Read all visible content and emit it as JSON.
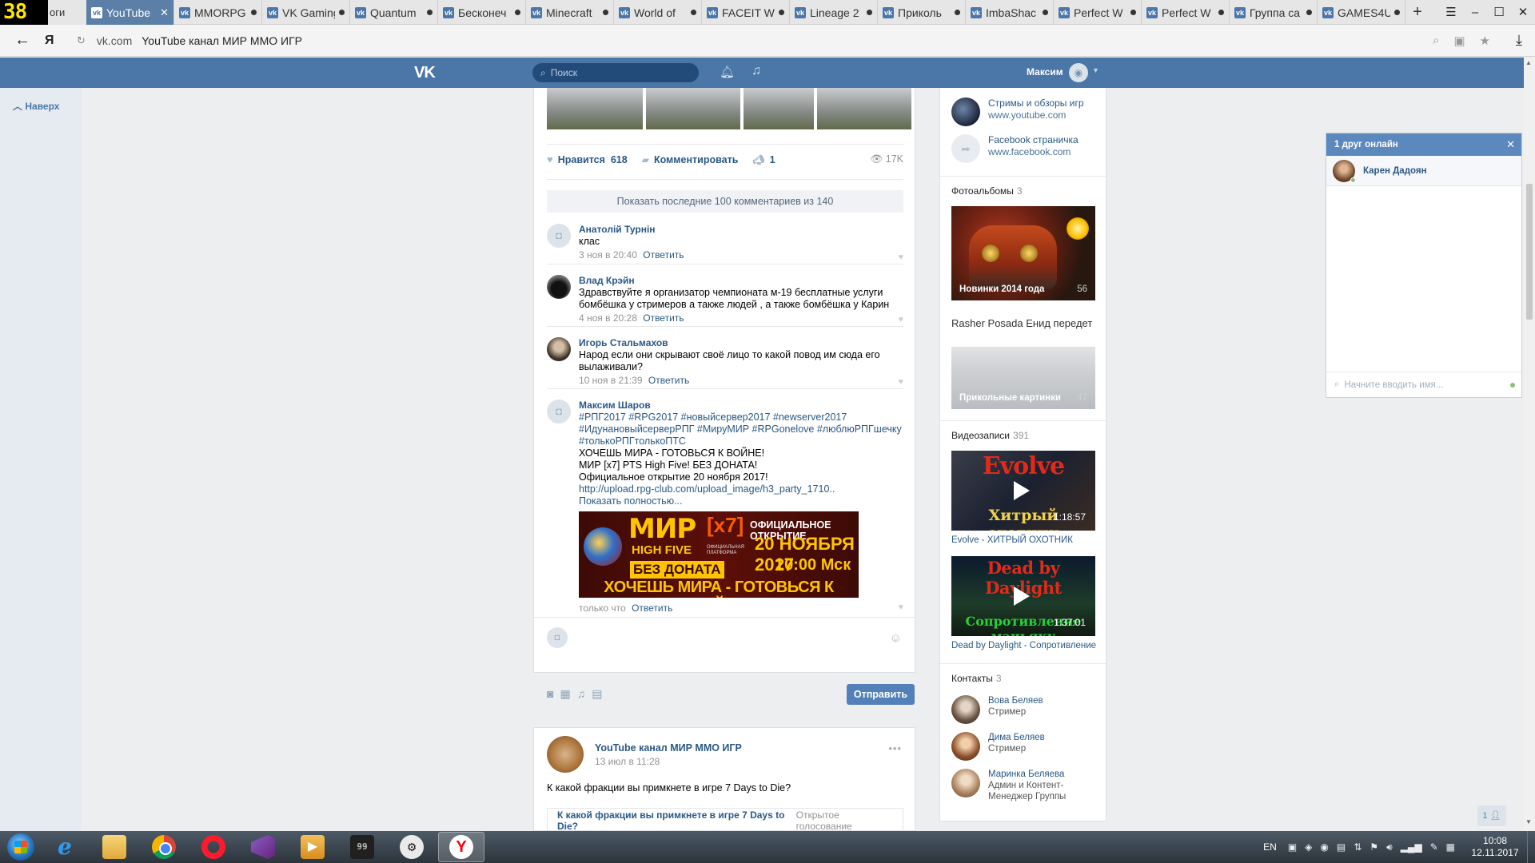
{
  "browser": {
    "fps": "38",
    "first_tab_tail": "оги",
    "tabs": [
      {
        "label": "YouTube",
        "active": true
      },
      {
        "label": "MMORPG",
        "active": false
      },
      {
        "label": "VK Gaming",
        "active": false
      },
      {
        "label": "Quantum",
        "active": false
      },
      {
        "label": "Бесконеч",
        "active": false
      },
      {
        "label": "Minecraft",
        "active": false
      },
      {
        "label": "World of",
        "active": false
      },
      {
        "label": "FACEIT W",
        "active": false
      },
      {
        "label": "Lineage 2",
        "active": false
      },
      {
        "label": "Приколь",
        "active": false
      },
      {
        "label": "ImbaShac",
        "active": false
      },
      {
        "label": "Perfect W",
        "active": false
      },
      {
        "label": "Perfect W",
        "active": false
      },
      {
        "label": "Группа ca",
        "active": false
      },
      {
        "label": "GAMES4U",
        "active": false
      }
    ],
    "address": {
      "domain": "vk.com",
      "title": "YouTube канал МИР ММО ИГР"
    }
  },
  "vk": {
    "search_placeholder": "Поиск",
    "user_name": "Максим",
    "back_to_top": "Наверх"
  },
  "post": {
    "likes_label": "Нравится",
    "likes_count": "618",
    "comment_label": "Комментировать",
    "shares": "1",
    "views": "17K",
    "show_comments": "Показать последние 100 комментариев из 140",
    "comments": [
      {
        "author": "Анатолій Турнін",
        "text": "клас",
        "time": "3 ноя в 20:40",
        "reply": "Ответить"
      },
      {
        "author": "Влад Крэйн",
        "text": "Здравствуйте я организатор чемпионата м-19 бесплатные услуги бомбёшка у стримеров а также людей , а также бомбёшка у Карин",
        "time": "4 ноя в 20:28",
        "reply": "Ответить"
      },
      {
        "author": "Игорь Стальмахов",
        "text": "Народ если они скрывают своё лицо то какой повод им сюда его вылаживали?",
        "time": "10 ноя в 21:39",
        "reply": "Ответить"
      },
      {
        "author": "Максим Шаров",
        "time": "только что",
        "reply": "Ответить"
      }
    ],
    "promo": {
      "hashtags": "#РПГ2017 #RPG2017 #новыйсервер2017 #newserver2017 #ИдунановыйсерверРПГ #МируМИР #RPGonelove #люблюРПГшечку #толькоРПГтолькоПТС",
      "line1": "ХОЧЕШЬ МИРА - ГОТОВЬСЯ К ВОЙНЕ!",
      "line2": "МИР [x7] PTS High Five! БЕЗ ДОНАТА!",
      "line3": "Официальное открытие 20 ноября 2017!",
      "link": "http://upload.rpg-club.com/upload_image/h3_party_1710..",
      "show_more": "Показать полностью..."
    },
    "banner": {
      "mir": "МИР",
      "x7": "[x7]",
      "high_five": "HIGH FIVE",
      "platform": "ОФИЦИАЛЬНАЯ ПЛАТФОРМА",
      "no_donate": "БЕЗ ДОНАТА",
      "opening": "ОФИЦИАЛЬНОЕ ОТКРЫТИЕ",
      "date": "20 НОЯБРЯ 2017",
      "time": "20:00 Мск",
      "war": "ХОЧЕШЬ МИРА - ГОТОВЬСЯ К ВОЙНЕ"
    },
    "send": "Отправить"
  },
  "post2": {
    "author": "YouTube канал МИР ММО ИГР",
    "date": "13 июл в 11:28",
    "text": "К какой фракции вы примкнете в игре 7 Days to Die?",
    "poll_question": "К какой фракции вы примкнете в игре 7 Days to Die?",
    "poll_type": "Открытое голосование"
  },
  "right": {
    "links": [
      {
        "title": "Стримы и обзоры игр",
        "url": "www.youtube.com"
      },
      {
        "title": "Facebook страничка",
        "url": "www.facebook.com"
      }
    ],
    "albums_label": "Фотоальбомы",
    "albums_count": "3",
    "album1": {
      "caption": "Новинки 2014 года",
      "count": "56"
    },
    "album2_top": "Rasher Posada   Енид передет",
    "album2": {
      "caption": "Прикольные картинки",
      "count": "47"
    },
    "videos_label": "Видеозаписи",
    "videos_count": "391",
    "video1": {
      "thumb_title": "Evolve",
      "thumb_sub": "Хитрый охотник",
      "duration": "1:18:57",
      "name": "Evolve - ХИТРЫЙ ОХОТНИК"
    },
    "video2": {
      "thumb_title": "Dead by Daylight",
      "thumb_sub": "Сопротивление маньяку",
      "duration": "1:37:01",
      "name": "Dead by Daylight - Сопротивление"
    },
    "contacts_label": "Контакты",
    "contacts_count": "3",
    "contacts": [
      {
        "name": "Вова Беляев",
        "role": "Стример"
      },
      {
        "name": "Дима Беляев",
        "role": "Стример"
      },
      {
        "name": "Маринка Беляева",
        "role": "Админ и Контент-Менеджер Группы"
      }
    ]
  },
  "chat": {
    "header": "1 друг онлайн",
    "friend": "Карен Дадоян",
    "input_placeholder": "Начните вводить имя..."
  },
  "fab_label": "1",
  "taskbar": {
    "lang": "EN",
    "time": "10:08",
    "date": "12.11.2017",
    "cmd_label": "99"
  }
}
